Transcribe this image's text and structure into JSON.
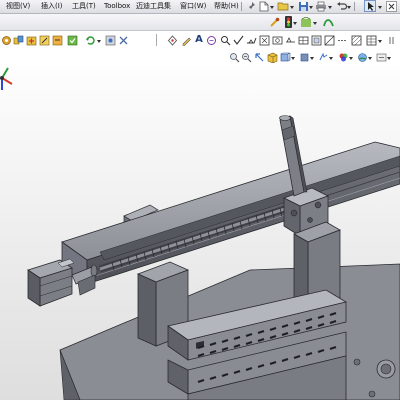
{
  "menu": {
    "items": [
      {
        "label": "视图(V)",
        "name": "menu-view"
      },
      {
        "label": "插入(I)",
        "name": "menu-insert"
      },
      {
        "label": "工具(T)",
        "name": "menu-tools"
      },
      {
        "label": "Toolbox",
        "name": "menu-toolbox"
      },
      {
        "label": "迈迪工具集",
        "name": "menu-maidi-tools"
      },
      {
        "label": "窗口(W)",
        "name": "menu-window"
      },
      {
        "label": "帮助(H)",
        "name": "menu-help"
      }
    ]
  },
  "toolbar": {
    "text_glyph": "A",
    "icons_row2": [
      "pin-icon",
      "new-document-icon",
      "open-folder-icon",
      "save-icon",
      "print-icon",
      "undo-icon",
      "select-arrow-icon",
      "close-document-icon"
    ],
    "icons_row3_left": [
      "assembly-icon",
      "mate-icon",
      "insert-component-icon",
      "sketch-icon",
      "smart-dimension-icon",
      "toolbox-icon",
      "rebuild-icon",
      "options-icon"
    ],
    "icons_row3_right": [
      "sketch-tool-icon",
      "pencil-icon",
      "note-text-icon",
      "balloon-icon",
      "zoom-icon",
      "check-icon",
      "weld-symbol-icon",
      "datum-icon",
      "surface-finish-icon",
      "hole-callout-icon",
      "tolerance-icon",
      "frame-icon",
      "datum-target-icon",
      "centerline-icon",
      "area-hatch-icon",
      "table-icon"
    ],
    "icons_row4": [
      "zoom-to-fit-icon",
      "zoom-area-icon",
      "previous-view-icon",
      "section-view-icon",
      "view-orientation-icon",
      "display-style-icon",
      "hide-show-items-icon",
      "edit-appearance-icon",
      "apply-scene-icon",
      "view-settings-icon"
    ]
  },
  "colors": {
    "model_gray": "#8a8c94",
    "model_dark": "#3c3e44",
    "viewport_top": "#fefefe",
    "viewport_bottom": "#dedede"
  },
  "viewport": {
    "model": "linear-stage-assembly"
  }
}
